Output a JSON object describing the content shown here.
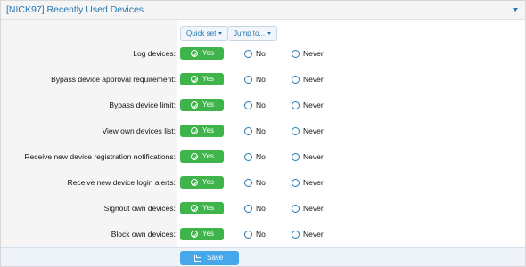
{
  "header": {
    "title": "[NICK97] Recently Used Devices"
  },
  "toolbar": {
    "quick_set": "Quick set",
    "jump_to": "Jump to..."
  },
  "options": {
    "yes": "Yes",
    "no": "No",
    "never": "Never"
  },
  "permissions": [
    {
      "label": "Log devices:",
      "value": "Yes"
    },
    {
      "label": "Bypass device approval requirement:",
      "value": "Yes"
    },
    {
      "label": "Bypass device limit:",
      "value": "Yes"
    },
    {
      "label": "View own devices list:",
      "value": "Yes"
    },
    {
      "label": "Receive new device registration notifications:",
      "value": "Yes"
    },
    {
      "label": "Receive new device login alerts:",
      "value": "Yes"
    },
    {
      "label": "Signout own devices:",
      "value": "Yes"
    },
    {
      "label": "Block own devices:",
      "value": "Yes"
    }
  ],
  "footer": {
    "save_label": "Save"
  },
  "colors": {
    "accent": "#2577b1",
    "yes_green": "#3fb44b",
    "save_blue": "#47a7eb"
  }
}
